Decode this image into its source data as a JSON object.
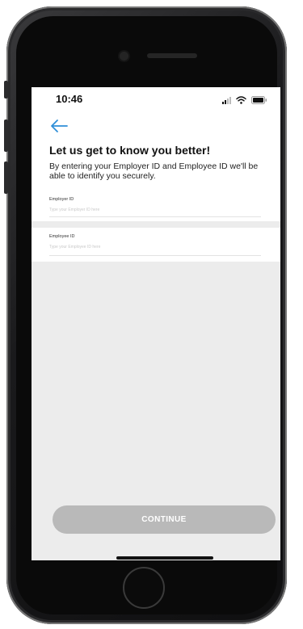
{
  "status_bar": {
    "time": "10:46"
  },
  "header": {
    "back_icon": "arrow-left-icon",
    "title": "Let us get to know you better!",
    "subtitle": "By entering your Employer ID and Employee ID we'll be able to identify you securely."
  },
  "form": {
    "employer": {
      "label": "Employer ID",
      "placeholder": "Type your Employer ID here",
      "value": ""
    },
    "employee": {
      "label": "Employee ID",
      "placeholder": "Type your Employee ID here",
      "value": ""
    }
  },
  "actions": {
    "continue_label": "CONTINUE"
  },
  "colors": {
    "accent": "#2f8fd8",
    "button_disabled": "#b9b9b9",
    "screen_background": "#ececec"
  }
}
